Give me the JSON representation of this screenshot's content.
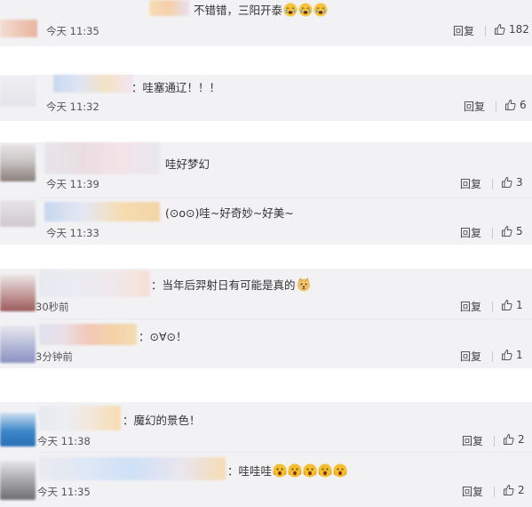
{
  "colors": {
    "page_background": "#ffffff",
    "card_background": "#f2f2f5",
    "text": "#333333"
  },
  "comments": [
    {
      "text": "不错错，三阳开泰",
      "emoji_icons": [
        "crying-face-icon",
        "crying-face-icon",
        "crying-face-icon"
      ],
      "time": "今天 11:35",
      "reply_label": "回复",
      "likes": "182"
    },
    {
      "text": "：哇塞通辽！！！",
      "time": "今天 11:32",
      "reply_label": "回复",
      "likes": "6"
    },
    {
      "text": "哇好梦幻",
      "time": "今天 11:39",
      "reply_label": "回复",
      "likes": "3"
    },
    {
      "text": "(⊙o⊙)哇~好奇妙~好美~",
      "time": "今天 11:33",
      "reply_label": "回复",
      "likes": "5"
    },
    {
      "text": "：当年后羿射日有可能是真的",
      "emoji_icons": [
        "doge-face-icon"
      ],
      "time": "30秒前",
      "reply_label": "回复",
      "likes": "1"
    },
    {
      "text": "：⊙∀⊙！",
      "time": "3分钟前",
      "reply_label": "回复",
      "likes": "1"
    },
    {
      "text": "：魔幻的景色！",
      "time": "今天 11:38",
      "reply_label": "回复",
      "likes": "2"
    },
    {
      "text": "：哇哇哇",
      "emoji_icons": [
        "shocked-face-icon",
        "shocked-face-icon",
        "shocked-face-icon",
        "shocked-face-icon",
        "shocked-face-icon"
      ],
      "time": "今天 11:35",
      "reply_label": "回复",
      "likes": "2"
    }
  ]
}
